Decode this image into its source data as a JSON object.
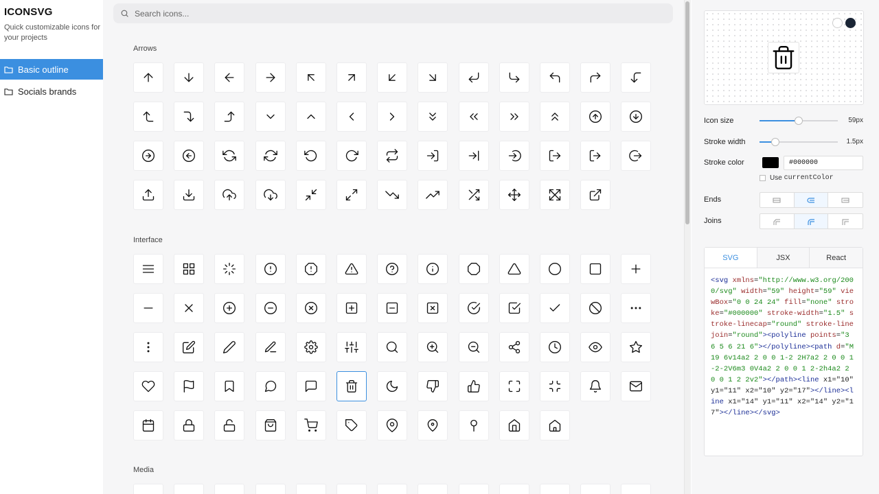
{
  "sidebar": {
    "logo": "ICONSVG",
    "tagline": "Quick customizable icons for your projects",
    "items": [
      {
        "label": "Basic outline",
        "active": true
      },
      {
        "label": "Socials brands",
        "active": false
      }
    ]
  },
  "search": {
    "placeholder": "Search icons..."
  },
  "sections": {
    "arrows": {
      "title": "Arrows",
      "icons": [
        "arrow-up",
        "arrow-down",
        "arrow-left",
        "arrow-right",
        "arrow-up-left",
        "arrow-up-right",
        "arrow-down-left",
        "arrow-down-right",
        "corner-down-left",
        "corner-down-right",
        "corner-up-left",
        "corner-up-right",
        "corner-left-down",
        "corner-left-up",
        "corner-right-down",
        "corner-right-up",
        "chevron-down",
        "chevron-up",
        "chevron-left",
        "chevron-right",
        "chevrons-down",
        "chevrons-left",
        "chevrons-right",
        "chevrons-up",
        "circle-arrow-up",
        "circle-arrow-down",
        "circle-arrow-right",
        "circle-arrow-left",
        "refresh-ccw",
        "refresh-cw",
        "rotate-ccw",
        "rotate-cw",
        "repeat",
        "log-in",
        "log-in-alt",
        "circle-arrow-in",
        "log-out",
        "log-out-alt",
        "circle-arrow-out",
        "upload",
        "download",
        "cloud-upload",
        "cloud-download",
        "minimize",
        "maximize",
        "trending-down",
        "trending-up",
        "shuffle",
        "move",
        "expand",
        "external-link"
      ]
    },
    "interface": {
      "title": "Interface",
      "icons": [
        "menu",
        "grid",
        "loader",
        "alert-circle",
        "alert-octagon",
        "alert-triangle",
        "help-circle",
        "info",
        "octagon",
        "triangle",
        "circle",
        "square",
        "plus",
        "minus",
        "x",
        "plus-circle",
        "minus-circle",
        "x-circle",
        "plus-square",
        "minus-square",
        "x-square",
        "check-circle",
        "check-square",
        "check",
        "slash",
        "more-horizontal",
        "more-vertical",
        "edit",
        "pencil",
        "edit-line",
        "settings",
        "sliders",
        "search",
        "zoom-in",
        "zoom-out",
        "share",
        "clock",
        "eye",
        "star",
        "heart",
        "flag",
        "bookmark",
        "message-circle",
        "message-square",
        "trash",
        "moon",
        "thumbs-down",
        "thumbs-up",
        "maximize-corners",
        "minimize-corners",
        "bell",
        "mail",
        "calendar",
        "lock",
        "unlock",
        "shopping-bag",
        "shopping-cart",
        "tag",
        "map-pin",
        "map-pin-alt",
        "pin",
        "home",
        "home-alt"
      ],
      "selected": "trash"
    },
    "media": {
      "title": "Media"
    }
  },
  "panel": {
    "icon_size_label": "Icon size",
    "icon_size_value": "59px",
    "icon_size_fraction": 0.5,
    "stroke_width_label": "Stroke width",
    "stroke_width_value": "1.5px",
    "stroke_width_fraction": 0.2,
    "stroke_color_label": "Stroke color",
    "stroke_color_value": "#000000",
    "use_current_prefix": "Use ",
    "use_current_code": "currentColor",
    "ends_label": "Ends",
    "joins_label": "Joins",
    "swatches": [
      "#ffffff",
      "#1a2535"
    ],
    "accent": "#3b8fe0"
  },
  "code": {
    "tabs": [
      "SVG",
      "JSX",
      "React"
    ],
    "active_tab": "SVG",
    "text": "<svg xmlns=\"http://www.w3.org/2000/svg\" width=\"59\" height=\"59\" viewBox=\"0 0 24 24\" fill=\"none\" stroke=\"#000000\" stroke-width=\"1.5\" stroke-linecap=\"round\" stroke-linejoin=\"round\"><polyline points=\"3 6 5 6 21 6\"></polyline><path d=\"M19 6v14a2 2 0 0 1-2 2H7a2 2 0 0 1-2-2V6m3 0V4a2 2 0 0 1 2-2h4a2 2 0 0 1 2 2v2\"></path><line x1=\"10\" y1=\"11\" x2=\"10\" y2=\"17\"></line><line x1=\"14\" y1=\"11\" x2=\"14\" y2=\"17\"></line></svg>"
  }
}
